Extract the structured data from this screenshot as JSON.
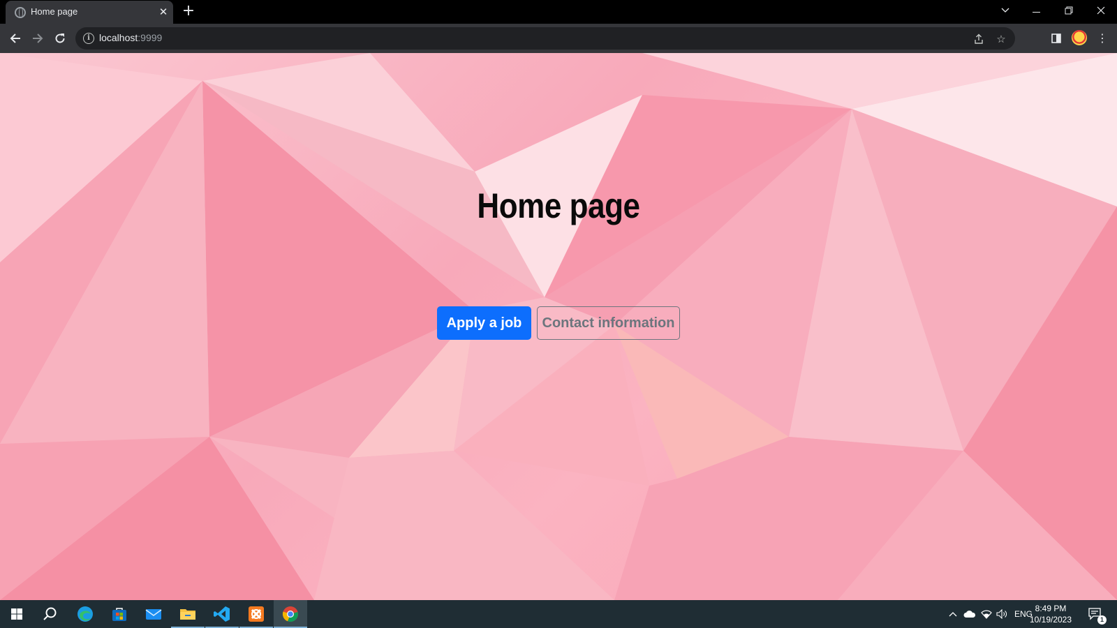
{
  "browser": {
    "tab_title": "Home page",
    "url_host": "localhost",
    "url_port": ":9999",
    "icons": {
      "tab_favicon": "globe-icon",
      "tab_close": "close-icon",
      "new_tab": "plus-icon",
      "tab_search": "chevron-down-icon",
      "minimize": "minimize-icon",
      "restore": "restore-icon",
      "close_window": "close-icon",
      "back": "arrow-left-icon",
      "forward": "arrow-right-icon",
      "reload": "reload-icon",
      "site_info": "info-icon",
      "share": "share-icon",
      "bookmark": "star-icon",
      "side_panel": "side-panel-icon",
      "profile": "avatar",
      "menu": "kebab-menu-icon"
    }
  },
  "page": {
    "heading": "Home page",
    "buttons": {
      "apply": "Apply a job",
      "contact": "Contact information"
    },
    "colors": {
      "primary": "#0d6efd",
      "outline": "#6c757d",
      "background": "#f9b0c0"
    }
  },
  "taskbar": {
    "apps": [
      "start-icon",
      "search-icon",
      "edge-icon",
      "store-icon",
      "mail-icon",
      "file-explorer-icon",
      "vscode-icon",
      "xampp-icon",
      "chrome-icon"
    ],
    "tray": {
      "language": "ENG",
      "time": "8:49 PM",
      "date": "10/19/2023",
      "notification_count": "1"
    }
  }
}
